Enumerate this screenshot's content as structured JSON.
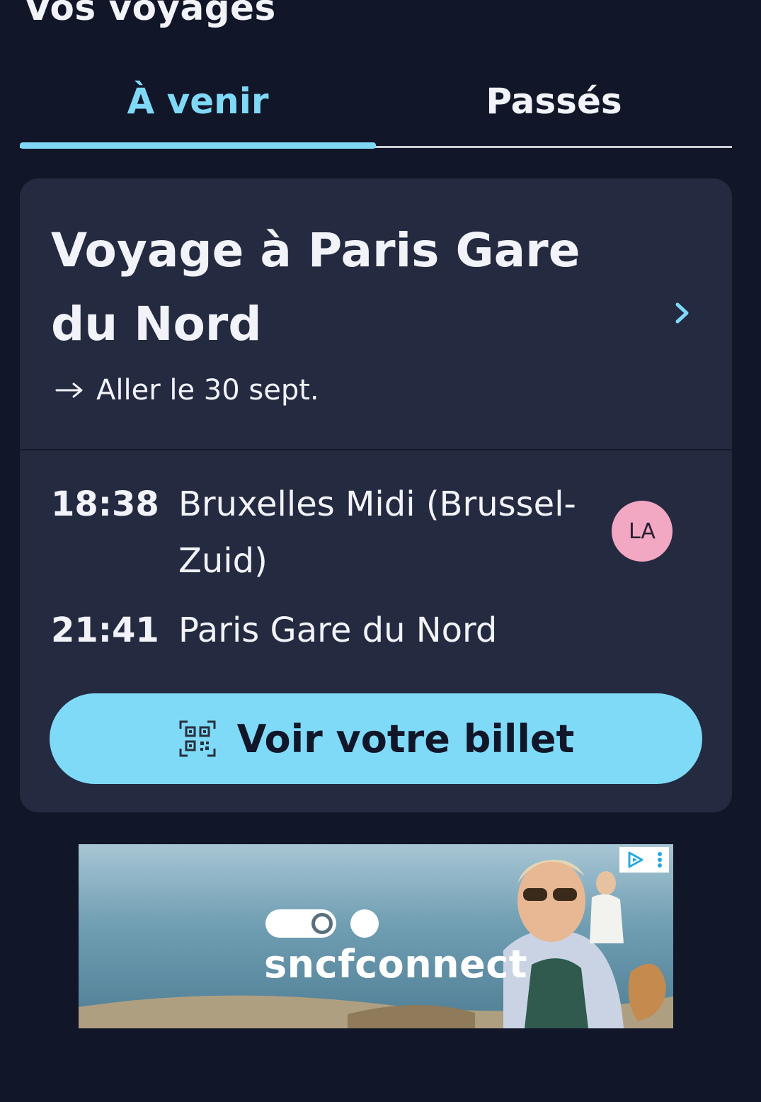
{
  "header": {
    "title": "Vos voyages"
  },
  "tabs": [
    {
      "label": "À venir",
      "active": true
    },
    {
      "label": "Passés",
      "active": false
    }
  ],
  "colors": {
    "background": "#111629",
    "card": "#242a40",
    "accent": "#7fd9f6",
    "avatar": "#f2a7c3"
  },
  "trip": {
    "title": "Voyage à Paris Gare du Nord",
    "chevron_icon": "chevron-right-icon",
    "outbound_icon": "arrow-right-icon",
    "outbound_label": "Aller le 30 sept.",
    "departure": {
      "time": "18:38",
      "station": "Bruxelles Midi (Brussel-Zuid)"
    },
    "arrival": {
      "time": "21:41",
      "station": "Paris Gare du Nord"
    },
    "traveler_initials": "LA",
    "ticket_button": {
      "icon": "qr-code-icon",
      "label": "Voir votre billet"
    }
  },
  "ad": {
    "brand": "sncfconnect",
    "choices_icon": "ad-choices-icon",
    "menu_icon": "more-vertical-icon"
  }
}
